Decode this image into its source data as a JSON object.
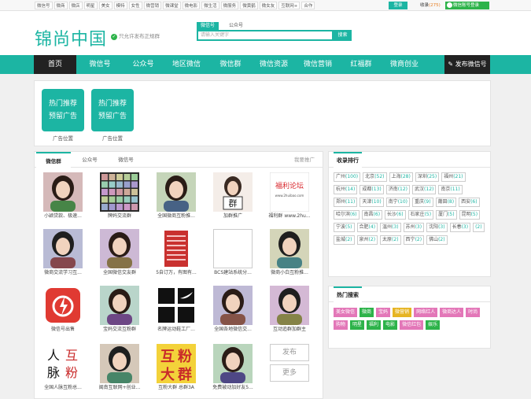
{
  "topbar": {
    "links": [
      "微信号",
      "微商",
      "微店",
      "明星",
      "美女",
      "模特",
      "女性",
      "微营销",
      "微课堂",
      "微电影",
      "微生活",
      "微服务",
      "微黄鹤",
      "微女友",
      "互联网+",
      "合作"
    ],
    "login_label": "登录",
    "collect_label": "收录",
    "collect_count": "(275)",
    "wechat_login_label": "微信账号登录"
  },
  "header": {
    "logo": "锦尚中国",
    "verified_text": "只允许发布正规群",
    "search_tabs": [
      "微信号",
      "公众号"
    ],
    "search_placeholder": "请输入关键字",
    "search_button": "搜索"
  },
  "nav": {
    "items": [
      "首页",
      "微信号",
      "公众号",
      "地区微信",
      "微信群",
      "微信资源",
      "微信营销",
      "红福群",
      "微商创业"
    ],
    "publish_label": "发布微信号"
  },
  "ads": [
    {
      "line1": "热门推荐",
      "line2": "预留广告",
      "caption": "广告位置"
    },
    {
      "line1": "热门推荐",
      "line2": "预留广告",
      "caption": "广告位置"
    }
  ],
  "main": {
    "tabs": [
      "微信群",
      "公众号",
      "微信号"
    ],
    "more_label": "我要推广",
    "items": [
      {
        "caption": "小颖贷款、极速...",
        "thumb": "portrait-woman"
      },
      {
        "caption": "牌妈交流群",
        "thumb": "chat-grid"
      },
      {
        "caption": "全国微商互粉推...",
        "thumb": "portrait-woman"
      },
      {
        "caption": "加群推广",
        "thumb": "badge-qun"
      },
      {
        "caption": "福利群 www.2hu...",
        "thumb": "forum-banner"
      },
      {
        "caption": "微商交流学习互...",
        "thumb": "portrait-man"
      },
      {
        "caption": "全国微信交友群",
        "thumb": "portrait-woman"
      },
      {
        "caption": "5自订万，有图有...",
        "thumb": "red-flyer"
      },
      {
        "caption": "BCS建站系统分...",
        "thumb": "empty"
      },
      {
        "caption": "微商小白互粉推...",
        "thumb": "portrait-man"
      },
      {
        "caption": "微信号出售",
        "thumb": "power-icon"
      },
      {
        "caption": "宝妈交流互粉群",
        "thumb": "portrait-woman"
      },
      {
        "caption": "名牌运动鞋工厂...",
        "thumb": "sport-logos"
      },
      {
        "caption": "全国各地微信交...",
        "thumb": "portrait-woman"
      },
      {
        "caption": "互动追群加群主",
        "thumb": "portrait-man"
      },
      {
        "caption": "全国人脉互粉总...",
        "thumb": "calligraphy"
      },
      {
        "caption": "闽南互联网+创业...",
        "thumb": "portrait-man"
      },
      {
        "caption": "互粉大群 总群3A",
        "thumb": "poster-huf"
      },
      {
        "caption": "免费被动加好友5...",
        "thumb": "portrait-woman"
      },
      {
        "caption": "",
        "thumb": "publish-more"
      }
    ],
    "forum_banner_title": "福利论坛",
    "forum_banner_url": "www.2huibao.com",
    "badge_text": "群",
    "calligraphy_chars": [
      "人",
      "互",
      "脉",
      "粉"
    ],
    "poster_chars": [
      "互",
      "粉",
      "大",
      "群"
    ],
    "publish_label": "发布",
    "more_label2": "更多"
  },
  "collect_rank": {
    "title": "收录排行",
    "cities": [
      {
        "name": "广州",
        "count": "(100)"
      },
      {
        "name": "北京",
        "count": "(52)"
      },
      {
        "name": "上海",
        "count": "(28)"
      },
      {
        "name": "深圳",
        "count": "(25)"
      },
      {
        "name": "福州",
        "count": "(21)"
      },
      {
        "name": "杭州",
        "count": "(14)"
      },
      {
        "name": "成都",
        "count": "(13)"
      },
      {
        "name": "济南",
        "count": "(12)"
      },
      {
        "name": "武汉",
        "count": "(12)"
      },
      {
        "name": "南京",
        "count": "(11)"
      },
      {
        "name": "郑州",
        "count": "(11)"
      },
      {
        "name": "天津",
        "count": "(10)"
      },
      {
        "name": "南宁",
        "count": "(10)"
      },
      {
        "name": "重庆",
        "count": "(9)"
      },
      {
        "name": "莆田",
        "count": "(8)"
      },
      {
        "name": "西安",
        "count": "(6)"
      },
      {
        "name": "哈尔滨",
        "count": "(6)"
      },
      {
        "name": "南昌",
        "count": "(6)"
      },
      {
        "name": "长沙",
        "count": "(6)"
      },
      {
        "name": "石家庄",
        "count": "(5)"
      },
      {
        "name": "厦门",
        "count": "(5)"
      },
      {
        "name": "昆明",
        "count": "(5)"
      },
      {
        "name": "宁波",
        "count": "(5)"
      },
      {
        "name": "合肥",
        "count": "(4)"
      },
      {
        "name": "温州",
        "count": "(3)"
      },
      {
        "name": "苏州",
        "count": "(3)"
      },
      {
        "name": "沈阳",
        "count": "(3)"
      },
      {
        "name": "长春",
        "count": "(3)"
      },
      {
        "name": "",
        "count": "(2)"
      },
      {
        "name": "盐城",
        "count": "(2)"
      },
      {
        "name": "泉州",
        "count": "(2)"
      },
      {
        "name": "太原",
        "count": "(2)"
      },
      {
        "name": "西宁",
        "count": "(2)"
      },
      {
        "name": "佛山",
        "count": "(2)"
      }
    ]
  },
  "hot_search": {
    "title": "热门搜索",
    "tags": [
      {
        "label": "美女微信",
        "color": "#e377b8"
      },
      {
        "label": "微商",
        "color": "#2db34a"
      },
      {
        "label": "宝妈",
        "color": "#e377b8"
      },
      {
        "label": "微营销",
        "color": "#e6b422"
      },
      {
        "label": "网络红人",
        "color": "#e377b8"
      },
      {
        "label": "微商达人",
        "color": "#e377b8"
      },
      {
        "label": "时尚",
        "color": "#e377b8"
      },
      {
        "label": "购物",
        "color": "#e377b8"
      },
      {
        "label": "明星",
        "color": "#2db34a"
      },
      {
        "label": "福利",
        "color": "#2db34a"
      },
      {
        "label": "电影",
        "color": "#2db34a"
      },
      {
        "label": "微信红包",
        "color": "#e377b8"
      },
      {
        "label": "娱乐",
        "color": "#2db34a"
      }
    ]
  },
  "colors": {
    "accent": "#1cb5a3",
    "dark": "#222222"
  }
}
